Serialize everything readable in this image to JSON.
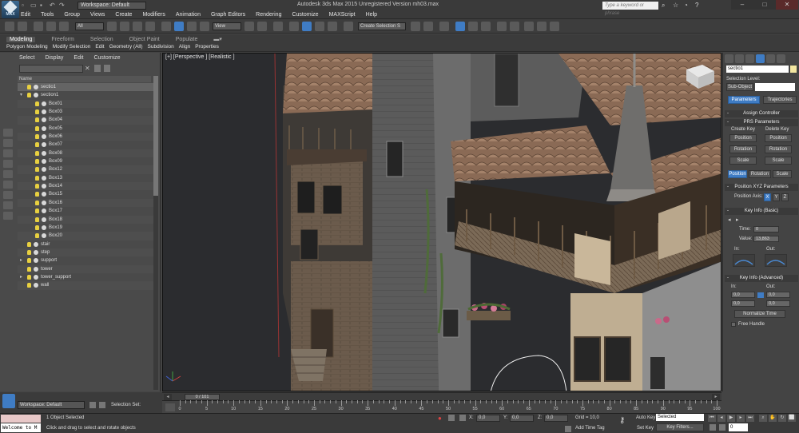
{
  "app": {
    "logo_text": "MAX",
    "workspace_label": "Workspace: Default",
    "title": "Autodesk 3ds Max 2015    Unregistered Version    mh03.max",
    "search_placeholder": "Type a keyword or phrase"
  },
  "menus": [
    "Edit",
    "Tools",
    "Group",
    "Views",
    "Create",
    "Modifiers",
    "Animation",
    "Graph Editors",
    "Rendering",
    "Customize",
    "MAXScript",
    "Help"
  ],
  "toolbar": {
    "filter_select": "All",
    "ref_coord_select": "View",
    "named_selection": "Create Selection S"
  },
  "ribbon": {
    "tabs": [
      "Modeling",
      "Freeform",
      "Selection",
      "Object Paint",
      "Populate"
    ],
    "active_tab": "Modeling",
    "items": [
      "Polygon Modeling",
      "Modify Selection",
      "Edit",
      "Geometry (All)",
      "Subdivision",
      "Align",
      "Properties"
    ]
  },
  "explorer": {
    "menu": [
      "Select",
      "Display",
      "Edit",
      "Customize"
    ],
    "column_header": "Name",
    "rows": [
      {
        "label": "sectio1",
        "level": 1,
        "selected": true
      },
      {
        "label": "section1",
        "level": 1,
        "expanded": true
      },
      {
        "label": "Box01",
        "level": 2
      },
      {
        "label": "Box03",
        "level": 2
      },
      {
        "label": "Box04",
        "level": 2
      },
      {
        "label": "Box05",
        "level": 2
      },
      {
        "label": "Box06",
        "level": 2
      },
      {
        "label": "Box07",
        "level": 2
      },
      {
        "label": "Box08",
        "level": 2
      },
      {
        "label": "Box09",
        "level": 2
      },
      {
        "label": "Box12",
        "level": 2
      },
      {
        "label": "Box13",
        "level": 2
      },
      {
        "label": "Box14",
        "level": 2
      },
      {
        "label": "Box15",
        "level": 2
      },
      {
        "label": "Box16",
        "level": 2
      },
      {
        "label": "Box17",
        "level": 2
      },
      {
        "label": "Box18",
        "level": 2
      },
      {
        "label": "Box19",
        "level": 2
      },
      {
        "label": "Box20",
        "level": 2
      },
      {
        "label": "stair",
        "level": 1
      },
      {
        "label": "step",
        "level": 1
      },
      {
        "label": "support",
        "level": 1,
        "collapsed": true
      },
      {
        "label": "tower",
        "level": 1
      },
      {
        "label": "tower_support",
        "level": 1,
        "collapsed": true
      },
      {
        "label": "wall",
        "level": 1
      }
    ]
  },
  "viewport": {
    "label": "[+] [Perspective ] [Realistic ]"
  },
  "command_panel": {
    "object_name": "sectio1",
    "selection_level_label": "Selection Level:",
    "sub_object_label": "Sub-Object",
    "parameters_btn": "Parameters",
    "trajectories_btn": "Trajectories",
    "assign_controller": "Assign Controller",
    "prs_parameters": "PRS Parameters",
    "create_key": "Create Key",
    "delete_key": "Delete Key",
    "position": "Position",
    "rotation": "Rotation",
    "scale": "Scale",
    "position_xyz": "Position XYZ Parameters",
    "position_axis": "Position Axis:",
    "axes": [
      "X",
      "Y",
      "Z"
    ],
    "key_info_basic": "Key Info (Basic)",
    "time_label": "Time:",
    "time_value": "0",
    "value_label": "Value:",
    "value_value": "13,863",
    "in_label": "In:",
    "out_label": "Out:",
    "key_info_advanced": "Key Info (Advanced)",
    "adv_in": "In:",
    "adv_out": "Out:",
    "adv_values": [
      "0,0",
      "0,0",
      "0,0",
      "0,0"
    ],
    "normalize_time": "Normalize Time",
    "free_handle": "Free Handle"
  },
  "timeline": {
    "slider_label": "0 / 101",
    "ticks": [
      "0",
      "5",
      "10",
      "15",
      "20",
      "25",
      "30",
      "35",
      "40",
      "45",
      "50",
      "55",
      "60",
      "65",
      "70",
      "75",
      "80",
      "85",
      "90",
      "95",
      "100"
    ]
  },
  "status": {
    "workspace_bottom": "Workspace: Default",
    "selection_set_label": "Selection Set:",
    "welcome": "Welcome to M",
    "objects_selected": "1 Object Selected",
    "prompt": "Click and drag to select and rotate objects",
    "x_label": "X:",
    "x_value": "0,0",
    "y_label": "Y:",
    "y_value": "0,0",
    "z_label": "Z:",
    "z_value": "0,0",
    "grid": "Grid = 10,0",
    "add_time_tag": "Add Time Tag",
    "auto_key": "Auto Key",
    "set_key": "Set Key",
    "key_mode_select": "Selected",
    "key_filters": "Key Filters...",
    "frame": "0"
  },
  "colors": {
    "accent": "#3f7cc4",
    "light_bulb": "#e8d040",
    "selection_swatch": "#f3e7a1"
  }
}
